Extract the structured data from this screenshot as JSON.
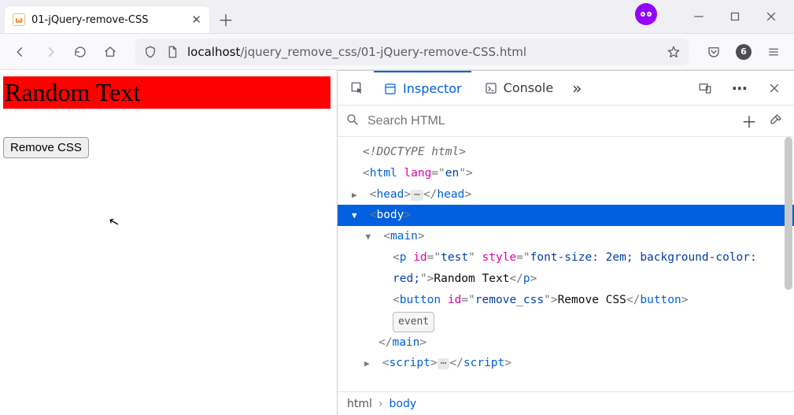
{
  "tab": {
    "title": "01-jQuery-remove-CSS"
  },
  "url": {
    "host": "localhost",
    "path": "/jquery_remove_css/01-jQuery-remove-CSS.html"
  },
  "toolbar_badge": "6",
  "page": {
    "random_text": "Random Text",
    "remove_css_label": "Remove CSS"
  },
  "devtools": {
    "tabs": {
      "inspector": "Inspector",
      "console": "Console"
    },
    "search_placeholder": "Search HTML",
    "event_pill": "event",
    "breadcrumbs": {
      "root": "html",
      "current": "body"
    },
    "dom": {
      "doctype": "<!DOCTYPE html>",
      "html_open": {
        "lang": "en"
      },
      "p": {
        "id": "test",
        "style": "font-size: 2em; background-color: red;",
        "text": "Random Text"
      },
      "button": {
        "id": "remove_css",
        "text": "Remove CSS"
      }
    }
  }
}
